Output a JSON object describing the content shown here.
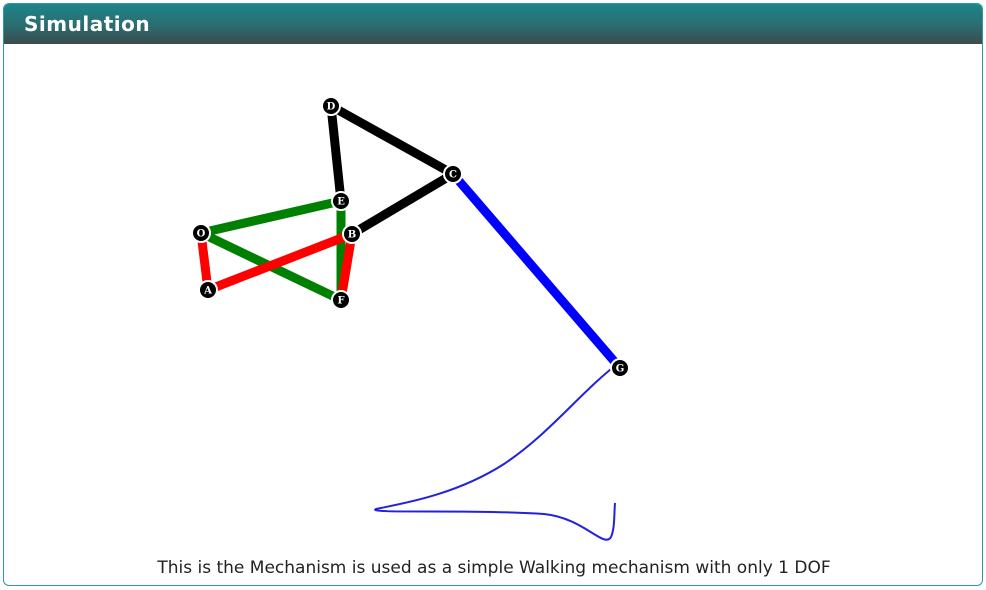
{
  "panel": {
    "title": "Simulation"
  },
  "mechanism": {
    "joints": [
      {
        "id": "O",
        "label": "O"
      },
      {
        "id": "A",
        "label": "A"
      },
      {
        "id": "B",
        "label": "B"
      },
      {
        "id": "E",
        "label": "E"
      },
      {
        "id": "F",
        "label": "F"
      },
      {
        "id": "D",
        "label": "D"
      },
      {
        "id": "C",
        "label": "C"
      },
      {
        "id": "G",
        "label": "G"
      }
    ],
    "link_colors": {
      "crank": "#ff0000",
      "ground_triangle": "#008000",
      "coupler_triangle": "#000000",
      "leg": "#0000ff",
      "trace": "#2222dd"
    }
  },
  "caption": "This is the Mechanism is used as a simple Walking mechanism with only 1 DOF"
}
